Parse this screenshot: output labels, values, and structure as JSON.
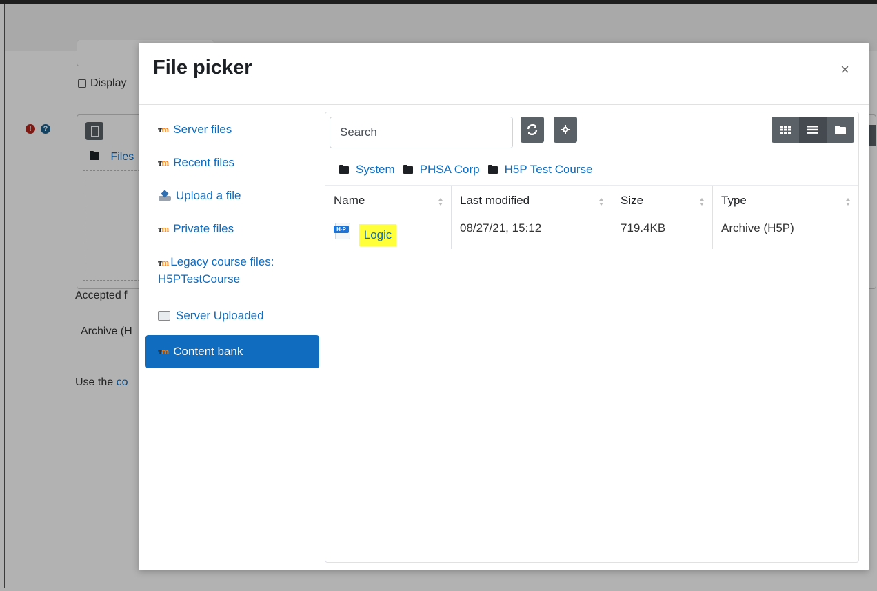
{
  "background": {
    "checkbox_label": "Display",
    "files_label": "Files",
    "accepted_label": "Accepted f",
    "archive_label": "Archive (H",
    "use_the_label": "Use the",
    "use_the_link": "co"
  },
  "modal": {
    "title": "File picker",
    "close_symbol": "×"
  },
  "sidebar": {
    "items": [
      {
        "label": "Server files",
        "icon": "moodle-icon"
      },
      {
        "label": "Recent files",
        "icon": "moodle-icon"
      },
      {
        "label": "Upload a file",
        "icon": "upload-icon"
      },
      {
        "label": "Private files",
        "icon": "moodle-icon"
      },
      {
        "label": "Legacy course files: H5PTestCourse",
        "icon": "moodle-icon"
      },
      {
        "label": "Server Uploaded",
        "icon": "server-icon"
      },
      {
        "label": "Content bank",
        "icon": "moodle-icon",
        "active": true
      }
    ]
  },
  "toolbar": {
    "search_placeholder": "Search",
    "refresh_icon": "refresh-icon",
    "settings_icon": "gear-icon",
    "views": [
      "grid-view-icon",
      "list-view-icon",
      "folder-view-icon"
    ],
    "active_view": "list-view-icon"
  },
  "breadcrumb": [
    "System",
    "PHSA Corp",
    "H5P Test Course"
  ],
  "table": {
    "columns": [
      "Name",
      "Last modified",
      "Size",
      "Type"
    ],
    "rows": [
      {
        "name": "Logic",
        "icon": "h5p-file-icon",
        "icon_text": "H-P",
        "last_modified": "08/27/21, 15:12",
        "size": "719.4KB",
        "type": "Archive (H5P)",
        "highlight_color": "#ffff3a"
      }
    ]
  },
  "colors": {
    "accent": "#0f6cbf",
    "button": "#5a6268",
    "highlight": "#ffff3a"
  }
}
